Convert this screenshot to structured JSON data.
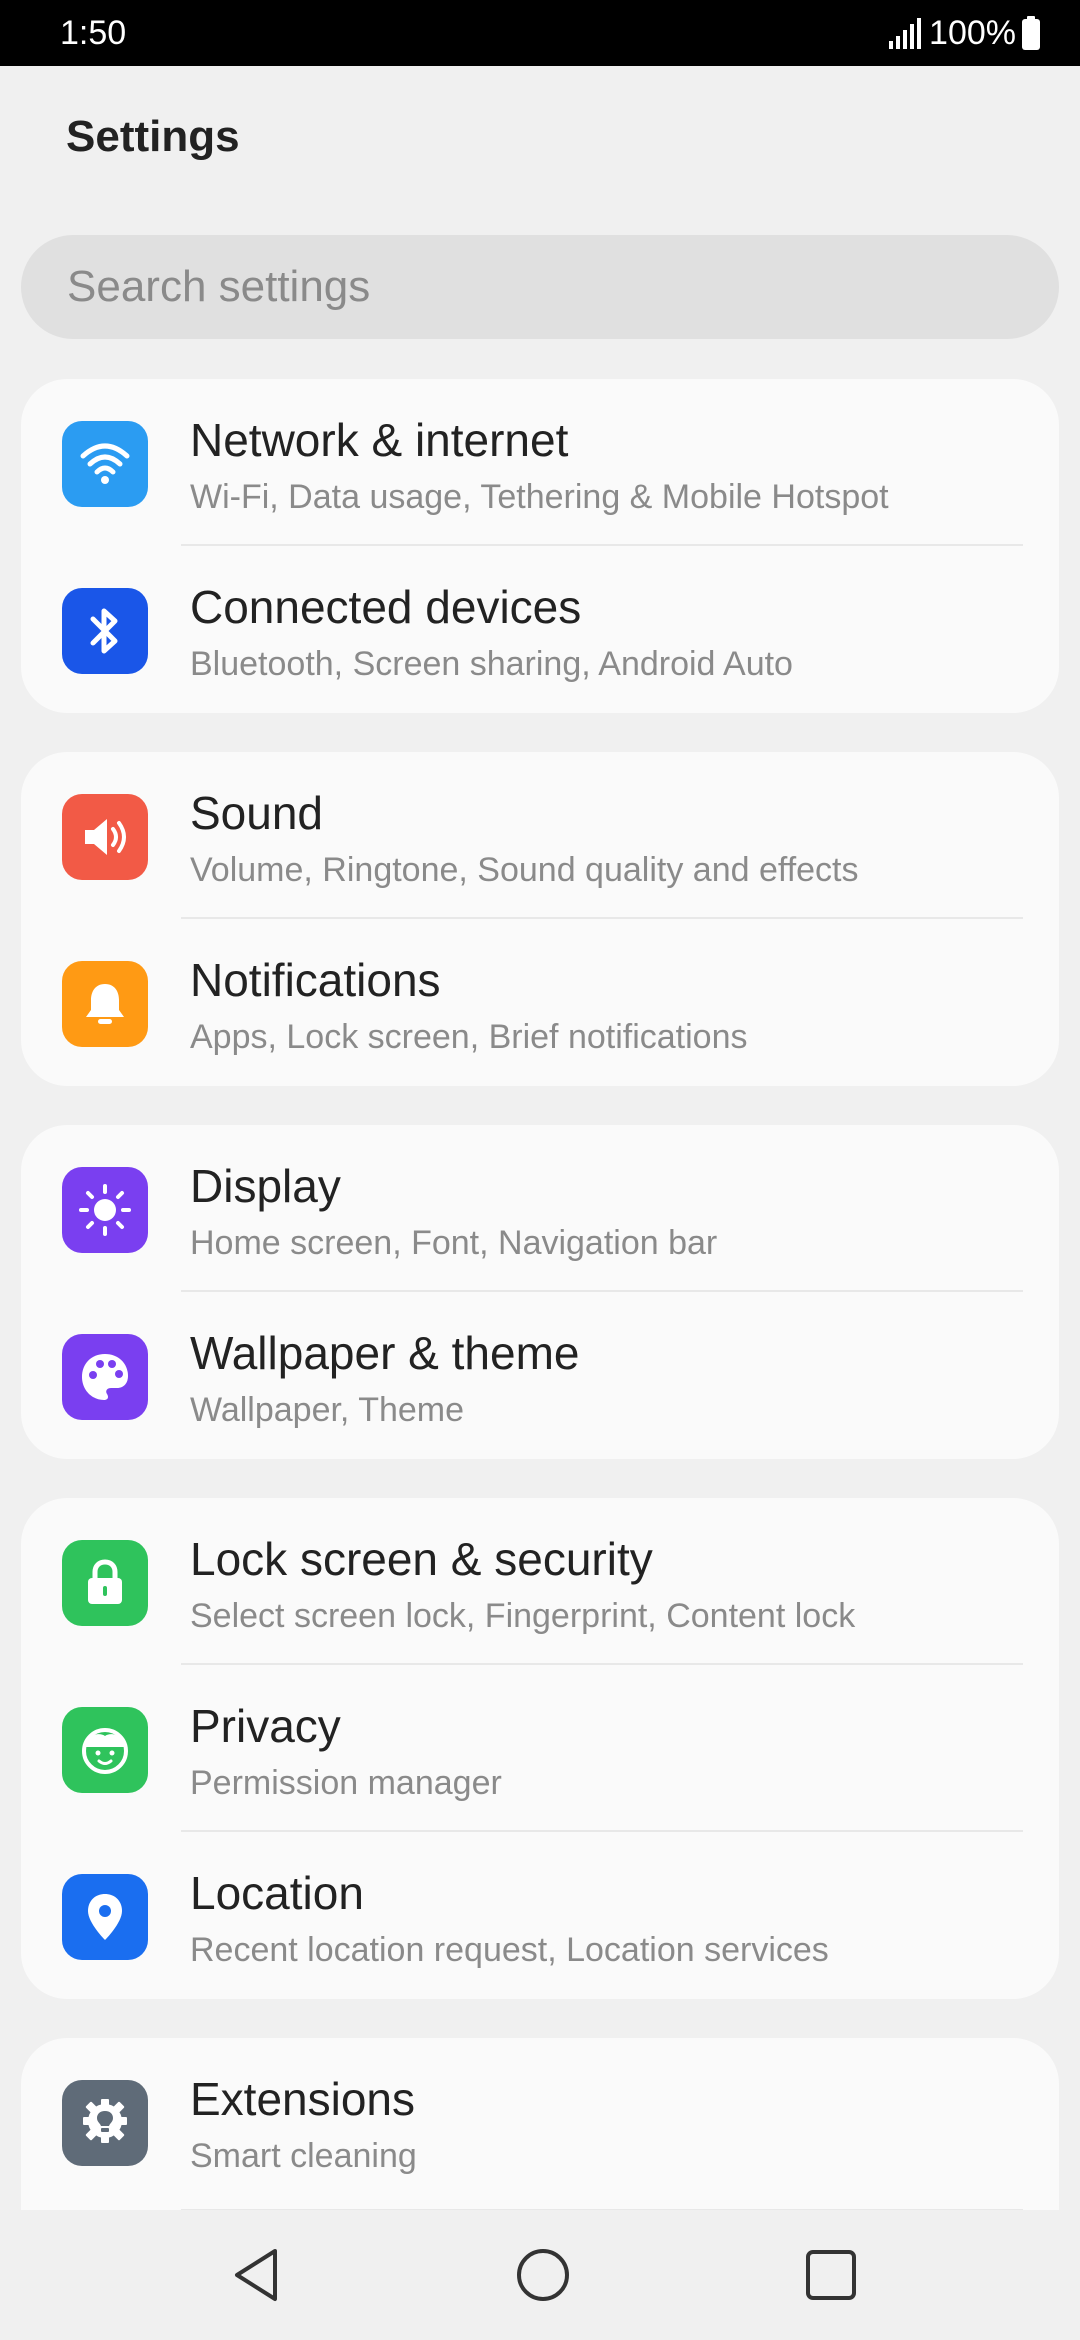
{
  "status_bar": {
    "time": "1:50",
    "battery": "100%"
  },
  "page": {
    "title": "Settings"
  },
  "search": {
    "placeholder": "Search settings"
  },
  "cards": [
    {
      "items": [
        {
          "title": "Network & internet",
          "subtitle": "Wi-Fi, Data usage, Tethering & Mobile Hotspot",
          "icon": "wifi-icon",
          "color": "#2b9cf2"
        },
        {
          "title": "Connected devices",
          "subtitle": "Bluetooth, Screen sharing, Android Auto",
          "icon": "bluetooth-icon",
          "color": "#1a56e8"
        }
      ]
    },
    {
      "items": [
        {
          "title": "Sound",
          "subtitle": "Volume, Ringtone, Sound quality and effects",
          "icon": "speaker-icon",
          "color": "#f25a46"
        },
        {
          "title": "Notifications",
          "subtitle": "Apps, Lock screen, Brief notifications",
          "icon": "bell-icon",
          "color": "#ff9a14"
        }
      ]
    },
    {
      "items": [
        {
          "title": "Display",
          "subtitle": "Home screen, Font, Navigation bar",
          "icon": "sun-icon",
          "color": "#7a3ff0"
        },
        {
          "title": "Wallpaper & theme",
          "subtitle": "Wallpaper, Theme",
          "icon": "palette-icon",
          "color": "#7a3ff0"
        }
      ]
    },
    {
      "items": [
        {
          "title": "Lock screen & security",
          "subtitle": "Select screen lock, Fingerprint, Content lock",
          "icon": "lock-icon",
          "color": "#2fc35c"
        },
        {
          "title": "Privacy",
          "subtitle": "Permission manager",
          "icon": "face-icon",
          "color": "#2fc35c"
        },
        {
          "title": "Location",
          "subtitle": "Recent location request, Location services",
          "icon": "location-pin-icon",
          "color": "#1a6ef0"
        }
      ]
    },
    {
      "items": [
        {
          "title": "Extensions",
          "subtitle": "Smart cleaning",
          "icon": "lightbulb-gear-icon",
          "color": "#5f6b78"
        }
      ]
    }
  ],
  "nav_bar": {
    "back_icon": "back-triangle-icon",
    "home_icon": "home-circle-icon",
    "recents_icon": "recents-square-icon"
  }
}
